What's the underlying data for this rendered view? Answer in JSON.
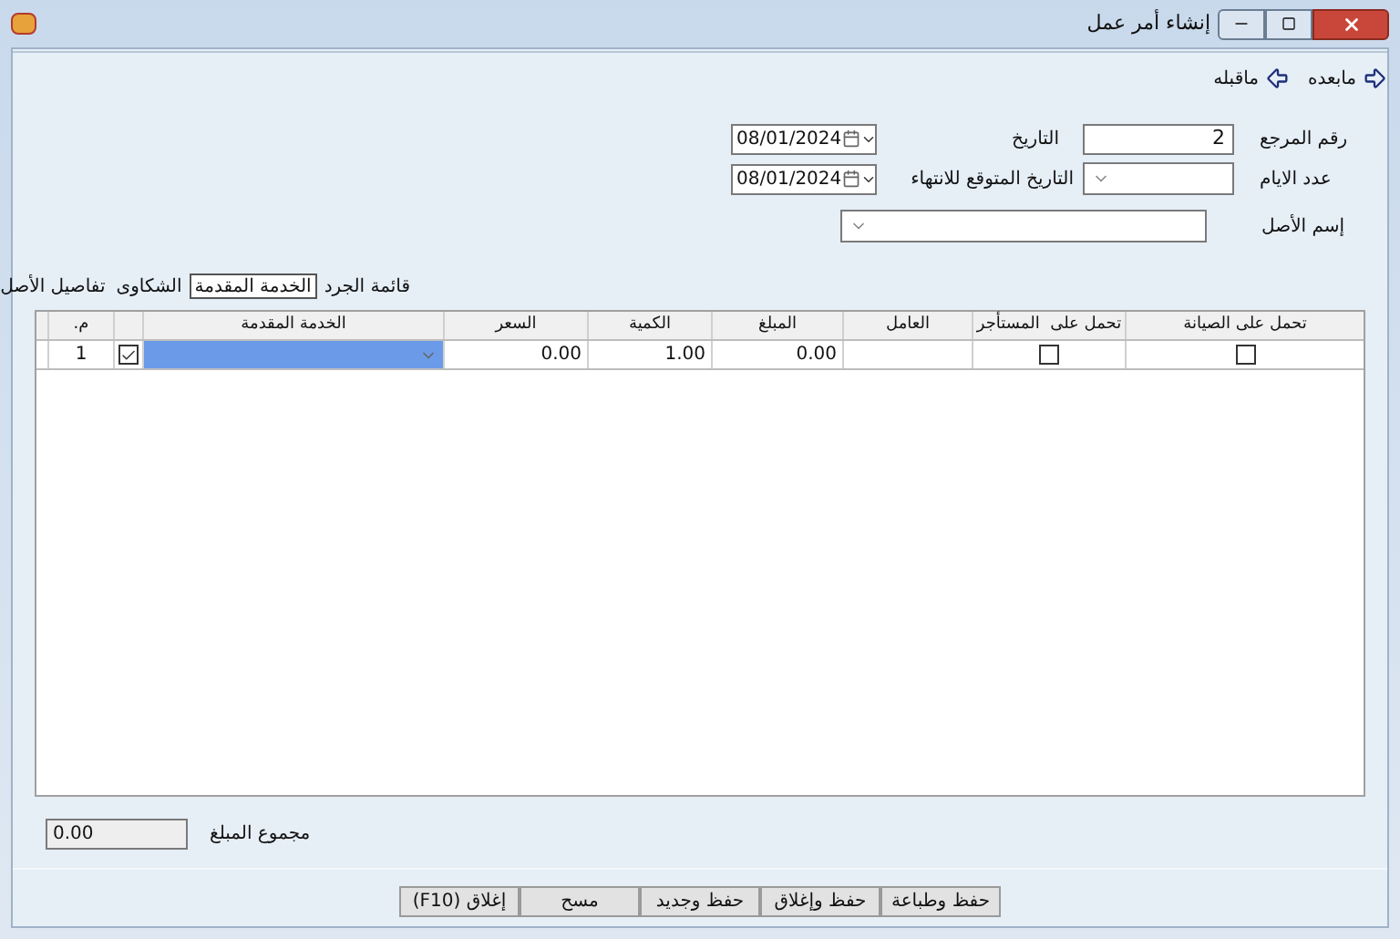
{
  "window": {
    "title": "إنشاء أمر عمل"
  },
  "toolbar": [
    {
      "kind": "next",
      "label": "مابعده"
    },
    {
      "kind": "prev",
      "label": "ماقبله"
    }
  ],
  "form": {
    "reference": {
      "label": "رقم المرجع",
      "value": "2"
    },
    "date": {
      "label": "التاريخ",
      "value": "08/01/2024"
    },
    "days": {
      "label": "عدد الايام"
    },
    "expected_end": {
      "label": "التاريخ المتوقع للانتهاء",
      "value": "08/01/2024"
    },
    "asset_name": {
      "label": "إسم الأصل"
    }
  },
  "tabs": [
    {
      "label": "قائمة الجرد",
      "selected": false
    },
    {
      "label": "الخدمة المقدمة",
      "selected": true
    },
    {
      "label": "الشكاوى",
      "selected": false
    },
    {
      "label": "تفاصيل الأصل",
      "selected": false
    }
  ],
  "table": {
    "columns": [
      {
        "kind": "maintenance",
        "label": "تحمل على الصيانة"
      },
      {
        "kind": "tenant",
        "label": "تحمل على  المستأجر"
      },
      {
        "kind": "worker",
        "label": "العامل"
      },
      {
        "kind": "amount",
        "label": "المبلغ"
      },
      {
        "kind": "quantity",
        "label": "الكمية"
      },
      {
        "kind": "price",
        "label": "السعر"
      },
      {
        "kind": "service",
        "label": "الخدمة المقدمة"
      },
      {
        "kind": "check"
      },
      {
        "kind": "number",
        "label": "م."
      }
    ],
    "rows": [
      {
        "number": "1",
        "checked": true,
        "service_selected": true,
        "price": "0.00",
        "quantity": "1.00",
        "amount": "0.00",
        "tenant": false,
        "maintenance": false
      }
    ]
  },
  "total": {
    "label": "مجموع المبلغ",
    "value": "0.00"
  },
  "buttons": [
    {
      "label": "حفظ وطباعة"
    },
    {
      "label": "حفظ وإغلاق"
    },
    {
      "label": "حفظ وجديد"
    },
    {
      "label": "مسح"
    },
    {
      "label": "إغلاق (F10)"
    }
  ]
}
